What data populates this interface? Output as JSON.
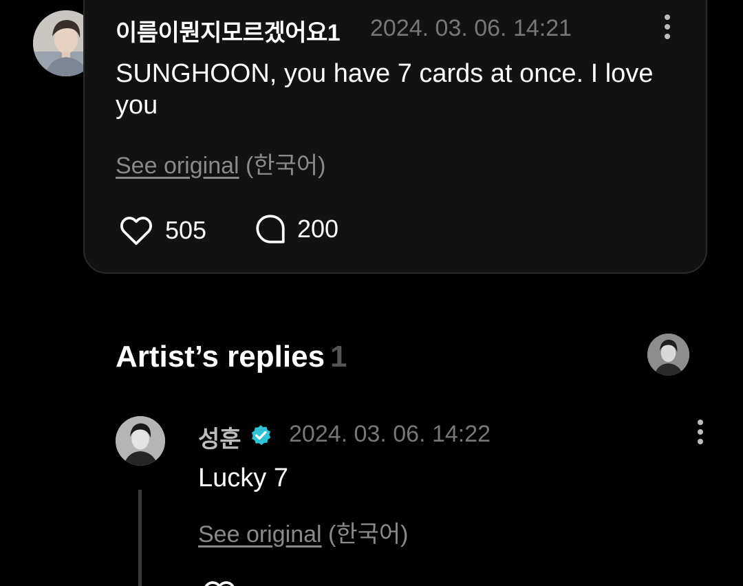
{
  "comment": {
    "username": "이름이뭔지모르겠어요1",
    "timestamp": "2024. 03. 06. 14:21",
    "text": "SUNGHOON, you have 7 cards at once. I love you",
    "see_original": "See original",
    "language": "(한국어)",
    "like_count": "505",
    "reply_count": "200"
  },
  "artist_replies": {
    "title": "Artist’s replies",
    "count": "1"
  },
  "reply": {
    "artist_name": "성훈",
    "timestamp": "2024. 03. 06. 14:22",
    "text": "Lucky 7",
    "see_original": "See original",
    "language": "(한국어)"
  },
  "icons": {
    "more": "more-vertical-icon",
    "like": "heart-icon",
    "comment": "comment-bubble-icon",
    "verified": "verified-badge-icon"
  },
  "colors": {
    "background": "#000000",
    "card": "#121212",
    "muted": "#777777",
    "verified": "#2ec4d6"
  }
}
